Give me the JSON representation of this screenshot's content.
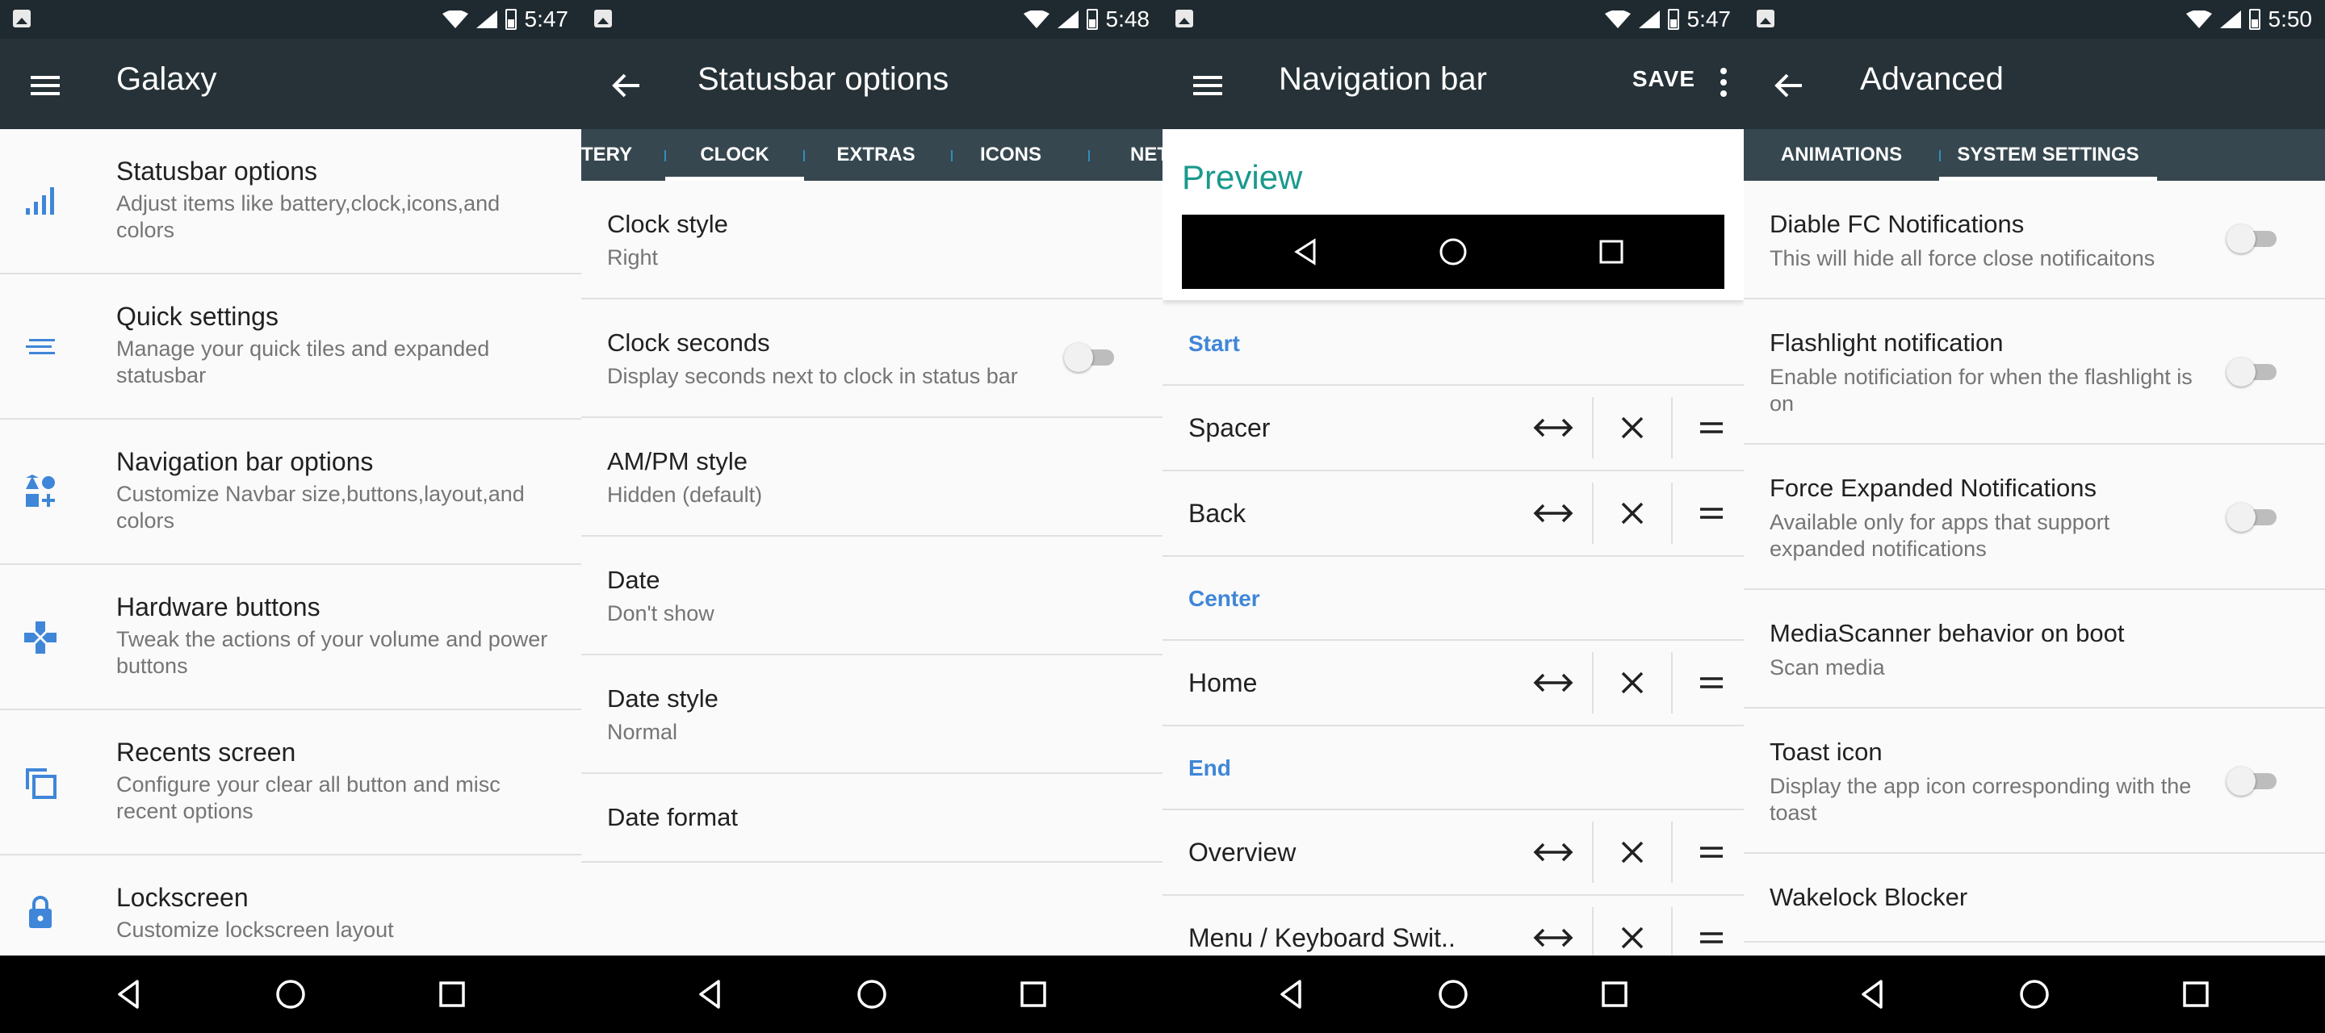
{
  "colors": {
    "accent": "#3f86d8",
    "preview": "#1a9a8c",
    "appbar": "#263238",
    "tabs": "#37474f"
  },
  "screens": [
    {
      "time": "5:47",
      "title": "Galaxy",
      "items": [
        {
          "icon": "signal-bars-icon",
          "title": "Statusbar options",
          "subtitle": "Adjust items like battery,clock,icons,and colors"
        },
        {
          "icon": "tiles-icon",
          "title": "Quick settings",
          "subtitle": "Manage your quick tiles and expanded statusbar"
        },
        {
          "icon": "shapes-icon",
          "title": "Navigation bar options",
          "subtitle": "Customize Navbar size,buttons,layout,and colors"
        },
        {
          "icon": "gamepad-icon",
          "title": "Hardware buttons",
          "subtitle": "Tweak the actions of your volume and power buttons"
        },
        {
          "icon": "recents-icon",
          "title": "Recents screen",
          "subtitle": "Configure your clear all button and misc recent options"
        },
        {
          "icon": "lock-icon",
          "title": "Lockscreen",
          "subtitle": "Customize lockscreen layout"
        }
      ]
    },
    {
      "time": "5:48",
      "title": "Statusbar options",
      "tabs": [
        "TERY",
        "CLOCK",
        "EXTRAS",
        "ICONS",
        "NET"
      ],
      "items": [
        {
          "title": "Clock style",
          "subtitle": "Right"
        },
        {
          "title": "Clock seconds",
          "subtitle": "Display seconds next to clock in status bar",
          "toggle": false
        },
        {
          "title": "AM/PM style",
          "subtitle": "Hidden (default)"
        },
        {
          "title": "Date",
          "subtitle": "Don't show"
        },
        {
          "title": "Date style",
          "subtitle": "Normal"
        },
        {
          "title": "Date format",
          "subtitle": ""
        }
      ]
    },
    {
      "time": "5:47",
      "title": "Navigation bar",
      "save": "SAVE",
      "preview": "Preview",
      "sections": [
        {
          "header": "Start",
          "rows": [
            "Spacer",
            "Back"
          ]
        },
        {
          "header": "Center",
          "rows": [
            "Home"
          ]
        },
        {
          "header": "End",
          "rows": [
            "Overview",
            "Menu / Keyboard Swit.."
          ]
        }
      ]
    },
    {
      "time": "5:50",
      "title": "Advanced",
      "tabs": [
        "ANIMATIONS",
        "SYSTEM SETTINGS"
      ],
      "items": [
        {
          "title": "Diable FC Notifications",
          "subtitle": "This will hide all force close notificaitons",
          "toggle": false
        },
        {
          "title": "Flashlight notification",
          "subtitle": "Enable notificiation for when the flashlight is on",
          "toggle": false
        },
        {
          "title": "Force Expanded Notifications",
          "subtitle": "Available only for apps that support expanded notifications",
          "toggle": false
        },
        {
          "title": "MediaScanner behavior on boot",
          "subtitle": "Scan media"
        },
        {
          "title": "Toast icon",
          "subtitle": "Display the app icon corresponding with the toast",
          "toggle": false
        },
        {
          "title": "Wakelock Blocker",
          "subtitle": ""
        }
      ]
    }
  ]
}
